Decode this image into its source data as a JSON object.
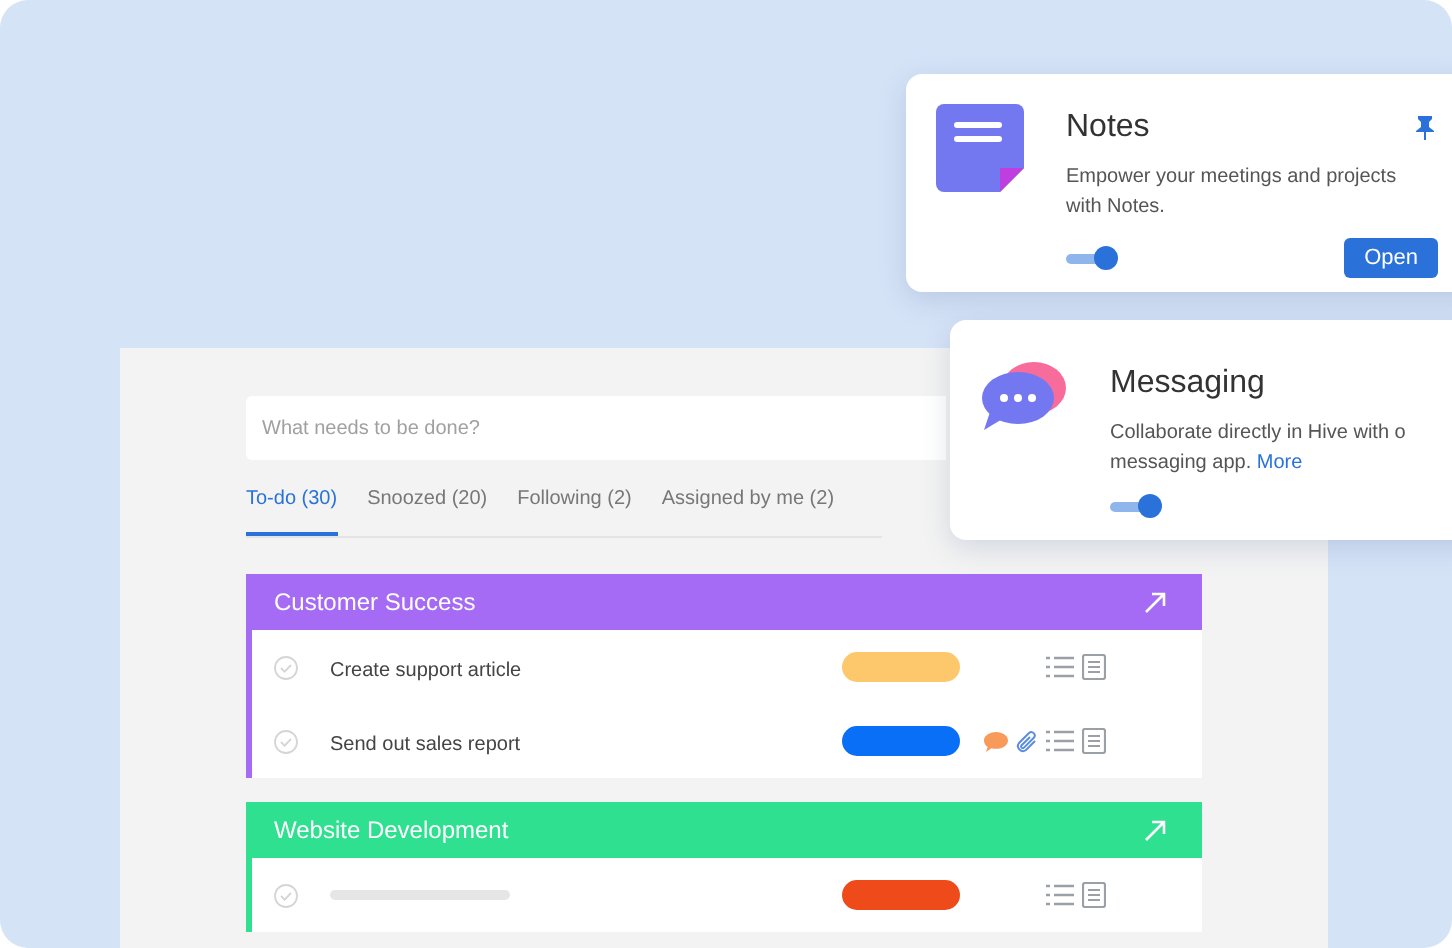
{
  "search": {
    "placeholder": "What needs to be done?"
  },
  "tabs": [
    {
      "label": "To-do (30)",
      "selected": true
    },
    {
      "label": "Snoozed (20)",
      "selected": false
    },
    {
      "label": "Following (2)",
      "selected": false
    },
    {
      "label": "Assigned by me (2)",
      "selected": false
    }
  ],
  "projects": [
    {
      "name": "Customer Success",
      "color": "#a56bf5",
      "tasks": [
        {
          "title": "Create support article",
          "color": "#fdc86b"
        },
        {
          "title": "Send out sales report",
          "color": "#0a6ff7",
          "comment": true,
          "attachment": true
        }
      ]
    },
    {
      "name": "Website Development",
      "color": "#2ee08f",
      "tasks": [
        {
          "color": "#ef4a1a"
        }
      ]
    }
  ],
  "apps": [
    {
      "kind": "notes",
      "title": "Notes",
      "lines": [
        "Empower your meetings and projects",
        "with Notes."
      ],
      "on": true,
      "pinned": true,
      "button": "Open"
    },
    {
      "kind": "messaging",
      "title": "Messaging",
      "lines": [
        "Collaborate directly in Hive with o",
        "messaging app."
      ],
      "link": "More",
      "on": true
    }
  ]
}
